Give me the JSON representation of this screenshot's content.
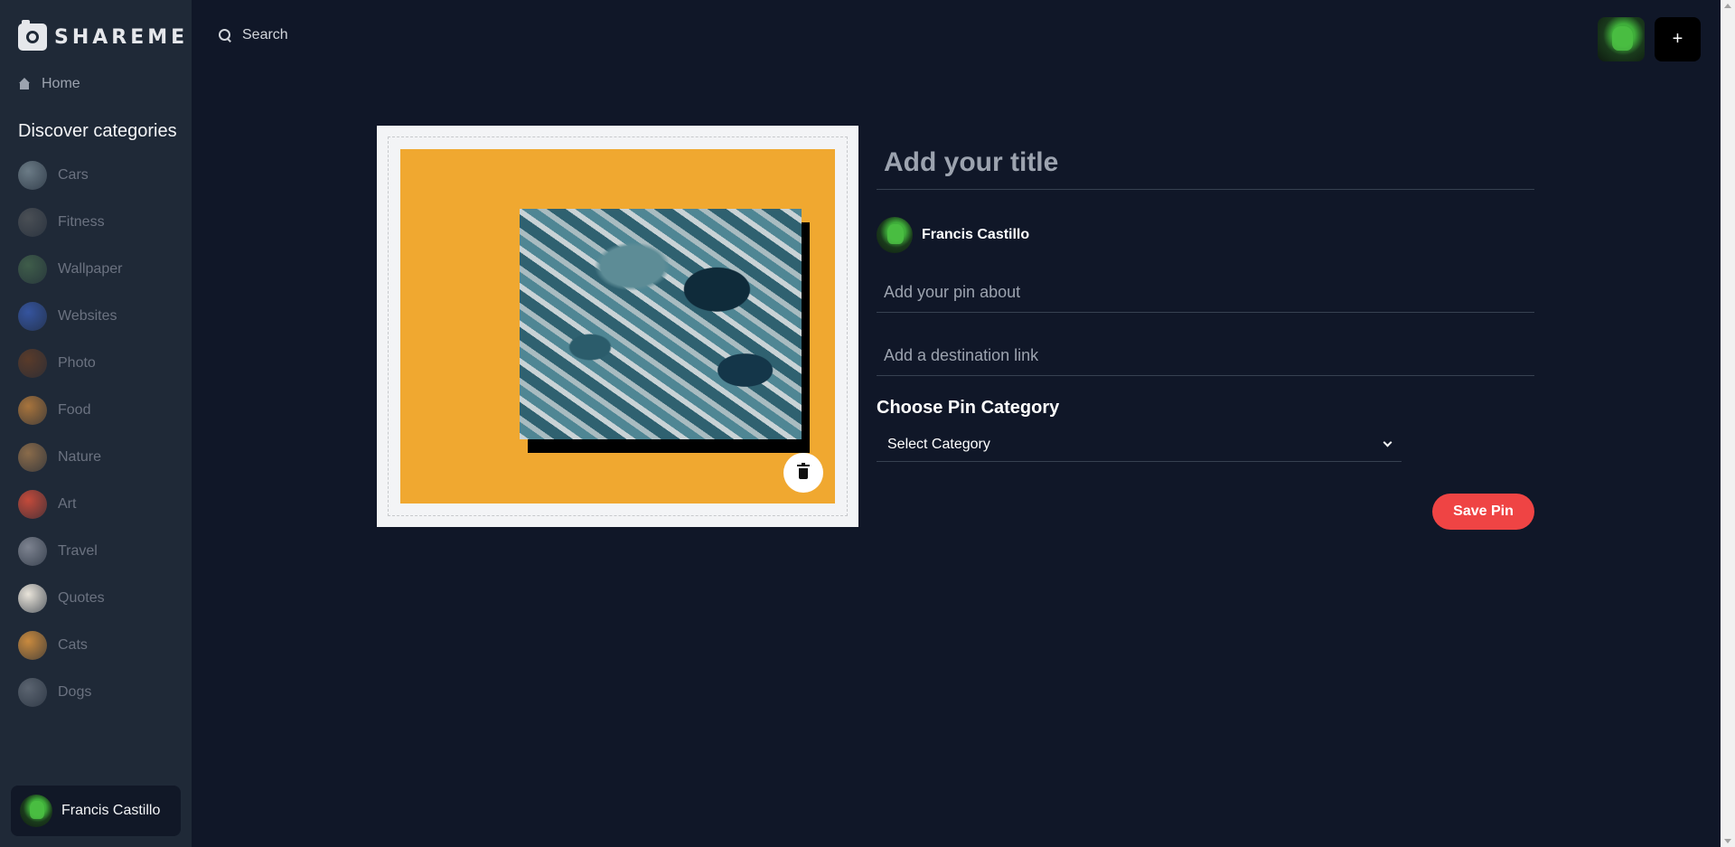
{
  "app": {
    "brand": "SHAREME"
  },
  "sidebar": {
    "home_label": "Home",
    "discover_title": "Discover categories",
    "categories": [
      {
        "label": "Cars",
        "color": "#6b7b86"
      },
      {
        "label": "Fitness",
        "color": "#4a4f55"
      },
      {
        "label": "Wallpaper",
        "color": "#3f5d4a"
      },
      {
        "label": "Websites",
        "color": "#35549e"
      },
      {
        "label": "Photo",
        "color": "#5a3b2a"
      },
      {
        "label": "Food",
        "color": "#a8743c"
      },
      {
        "label": "Nature",
        "color": "#8a6b4a"
      },
      {
        "label": "Art",
        "color": "#c34a3a"
      },
      {
        "label": "Travel",
        "color": "#7d8390"
      },
      {
        "label": "Quotes",
        "color": "#e9e4da"
      },
      {
        "label": "Cats",
        "color": "#c98a3e"
      },
      {
        "label": "Dogs",
        "color": "#5b6470"
      }
    ],
    "user_name": "Francis Castillo"
  },
  "topbar": {
    "search_placeholder": "Search",
    "add_label": "+"
  },
  "form": {
    "title_placeholder": "Add your title",
    "author_name": "Francis Castillo",
    "about_placeholder": "Add your pin about",
    "link_placeholder": "Add a destination link",
    "category_heading": "Choose Pin Category",
    "category_selected": "Select Category",
    "save_label": "Save Pin"
  },
  "colors": {
    "background": "#101728",
    "sidebar": "#1f2937",
    "accent": "#ef4444",
    "preview_bg": "#f0a830"
  }
}
